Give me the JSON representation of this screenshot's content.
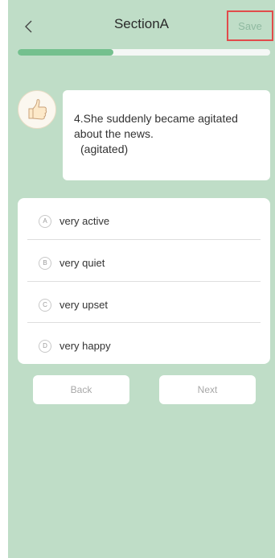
{
  "header": {
    "back_icon": "chevron-left-icon",
    "title": "SectionA",
    "save_label": "Save"
  },
  "progress": {
    "fraction": 0.38
  },
  "question": {
    "avatar_icon": "thumbs-up-icon",
    "text": "4.She suddenly became agitated about the news.",
    "hint": "(agitated)"
  },
  "options": [
    {
      "letter": "A",
      "text": "very active"
    },
    {
      "letter": "B",
      "text": "very quiet"
    },
    {
      "letter": "C",
      "text": "very upset"
    },
    {
      "letter": "D",
      "text": "very happy"
    }
  ],
  "nav": {
    "back_label": "Back",
    "next_label": "Next"
  },
  "colors": {
    "background": "#bfddc7",
    "progress_fill": "#74c08e",
    "save_text": "#8fb9a0",
    "save_border": "#e14b4b"
  }
}
